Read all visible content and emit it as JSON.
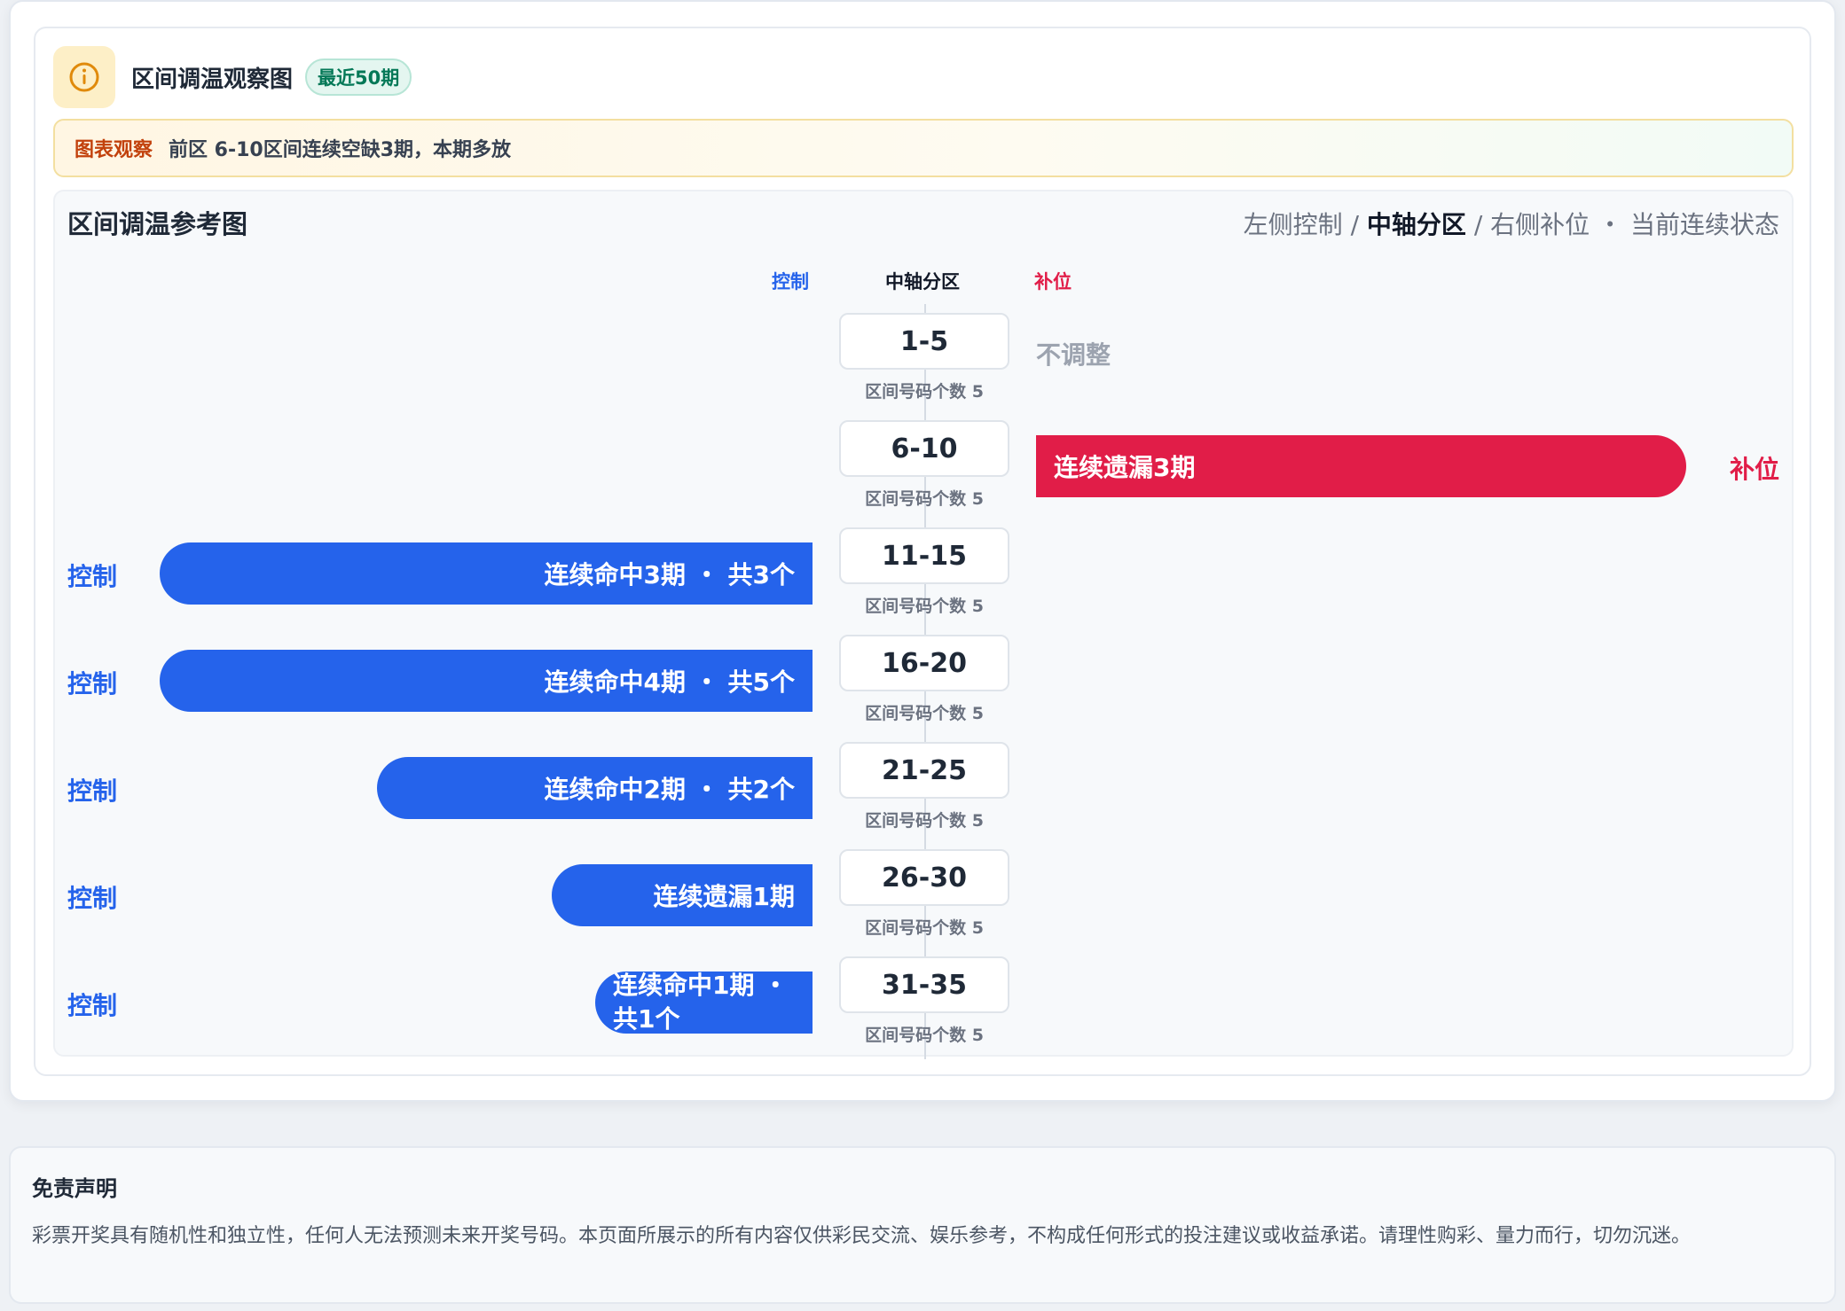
{
  "panel": {
    "title": "区间调温观察图",
    "badge": "最近50期",
    "icon": "info-icon"
  },
  "observation": {
    "label": "图表观察",
    "text": "前区 6-10区间连续空缺3期，本期多放"
  },
  "chart": {
    "title": "区间调温参考图",
    "legend": {
      "left": "左侧控制",
      "sep1": " / ",
      "mid": "中轴分区",
      "sep2": " / ",
      "right": "右侧补位",
      "dot": " ・ ",
      "state": "当前连续状态"
    },
    "col_left": "控制",
    "col_mid": "中轴分区",
    "col_right": "补位"
  },
  "chart_data": {
    "type": "bar",
    "categories": [
      "1-5",
      "6-10",
      "11-15",
      "16-20",
      "21-25",
      "26-30",
      "31-35"
    ],
    "count_label": "区间号码个数 5",
    "rows": [
      {
        "zone": "1-5",
        "side": "none",
        "periods": 0,
        "bar_text": "",
        "side_label": "不调整"
      },
      {
        "zone": "6-10",
        "side": "right",
        "status": "连续遗漏",
        "periods": 3,
        "bar_text": "连续遗漏3期",
        "side_label": "补位"
      },
      {
        "zone": "11-15",
        "side": "left",
        "status": "连续命中",
        "periods": 3,
        "total": 3,
        "bar_text": "连续命中3期 ・ 共3个",
        "side_label": "控制"
      },
      {
        "zone": "16-20",
        "side": "left",
        "status": "连续命中",
        "periods": 4,
        "total": 5,
        "bar_text": "连续命中4期 ・ 共5个",
        "side_label": "控制"
      },
      {
        "zone": "21-25",
        "side": "left",
        "status": "连续命中",
        "periods": 2,
        "total": 2,
        "bar_text": "连续命中2期 ・ 共2个",
        "side_label": "控制"
      },
      {
        "zone": "26-30",
        "side": "left",
        "status": "连续遗漏",
        "periods": 1,
        "bar_text": "连续遗漏1期",
        "side_label": "控制"
      },
      {
        "zone": "31-35",
        "side": "left",
        "status": "连续命中",
        "periods": 1,
        "total": 1,
        "bar_text": "连续命中1期 ・ 共1个",
        "side_label": "控制"
      }
    ],
    "colors": {
      "left": "#2563eb",
      "right": "#e11d48"
    }
  },
  "disclaimer": {
    "title": "免责声明",
    "text": "彩票开奖具有随机性和独立性，任何人无法预测未来开奖号码。本页面所展示的所有内容仅供彩民交流、娱乐参考，不构成任何形式的投注建议或收益承诺。请理性购彩、量力而行，切勿沉迷。"
  }
}
